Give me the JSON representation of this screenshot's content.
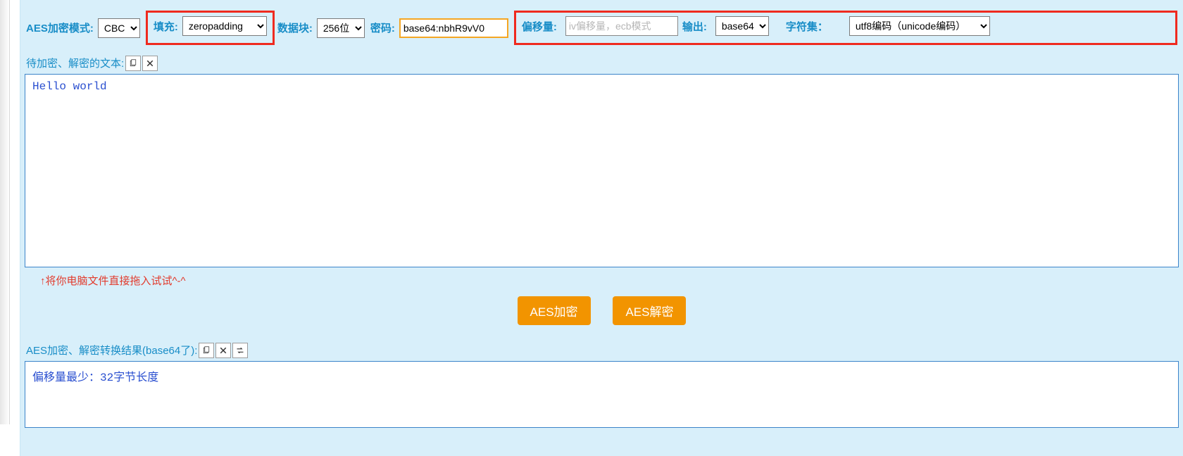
{
  "top": {
    "mode_label": "AES加密模式:",
    "mode_value": "CBC",
    "pad_label": "填充:",
    "pad_value": "zeropadding",
    "block_label": "数据块:",
    "block_value": "256位",
    "pwd_label": "密码:",
    "pwd_value": "base64:nbhR9vV0",
    "iv_label": "偏移量:",
    "iv_placeholder": "iv偏移量，ecb模式",
    "iv_value": "",
    "out_label": "输出:",
    "out_value": "base64",
    "charset_label": "字符集：",
    "charset_value": "utf8编码（unicode编码）"
  },
  "input_section_label": "待加密、解密的文本:",
  "input_text": "Hello world",
  "drag_hint": "↑将你电脑文件直接拖入试试^-^",
  "buttons": {
    "encrypt": "AES加密",
    "decrypt": "AES解密"
  },
  "output_section_label": "AES加密、解密转换结果(base64了):",
  "output_text": "偏移量最少：32字节长度"
}
